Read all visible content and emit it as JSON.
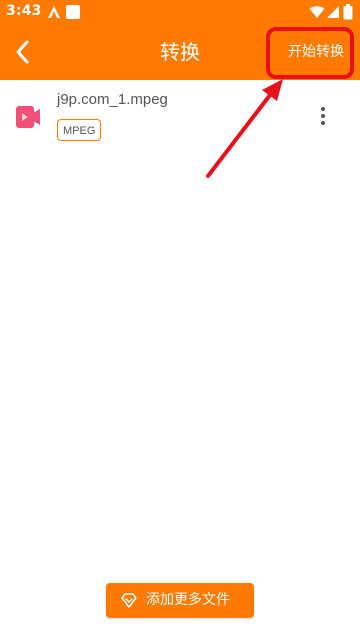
{
  "status_bar": {
    "time": "3:43"
  },
  "app_bar": {
    "title": "转换",
    "start_button": "开始转换"
  },
  "files": [
    {
      "name": "j9p.com_1.mpeg",
      "format_tag": "MPEG"
    }
  ],
  "bottom": {
    "add_more_button": "添加更多文件"
  },
  "colors": {
    "primary": "#ff7a00",
    "highlight": "#e8101a",
    "video_icon": "#f0507a"
  },
  "icons": {
    "back": "back-arrow-icon",
    "more": "more-vert-icon",
    "file": "video-file-icon",
    "add": "diamond-add-icon"
  }
}
